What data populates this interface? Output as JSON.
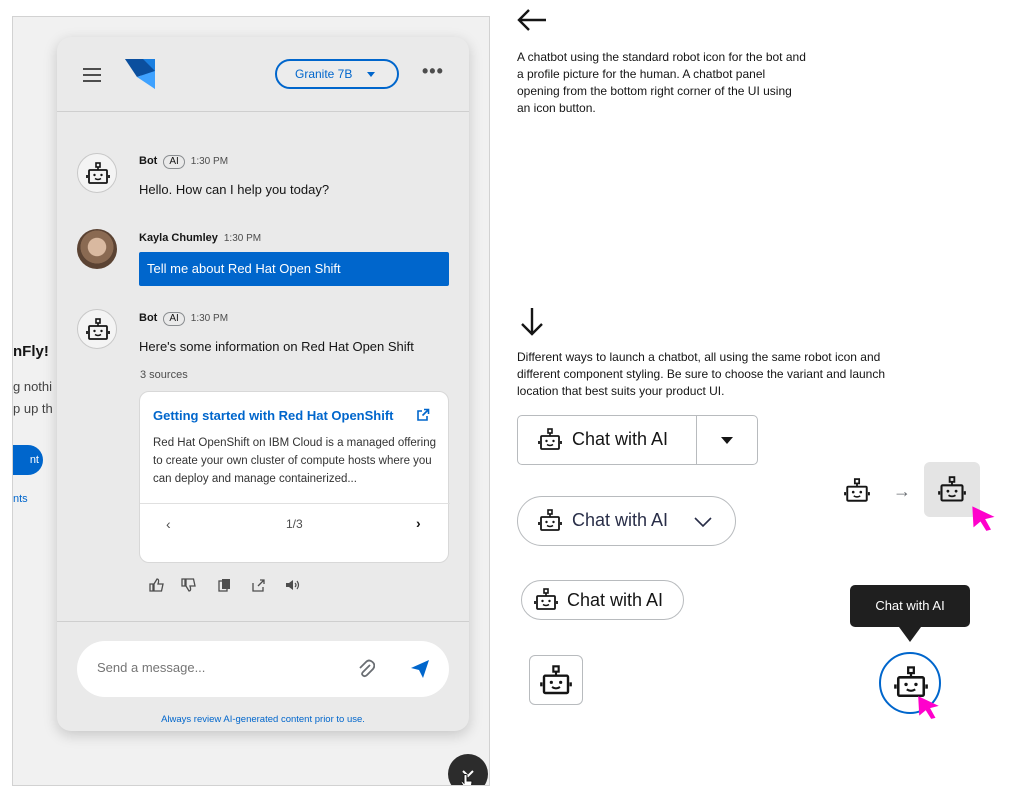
{
  "background_page": {
    "headline": "nFly!",
    "lines": [
      "g nothi",
      "p up th"
    ],
    "button_label": "nt",
    "link_label": "nts"
  },
  "chatbot": {
    "header": {
      "menu_icon": "hamburger-icon",
      "logo_icon": "app-logo",
      "model_selector": "Granite 7B",
      "options_icon": "kebab-icon"
    },
    "messages": [
      {
        "role": "bot",
        "name": "Bot",
        "badge": "AI",
        "time": "1:30 PM",
        "text": "Hello. How can I help you today?"
      },
      {
        "role": "user",
        "name": "Kayla Chumley",
        "time": "1:30 PM",
        "text": "Tell me about Red Hat Open Shift"
      },
      {
        "role": "bot",
        "name": "Bot",
        "badge": "AI",
        "time": "1:30 PM",
        "text": "Here's some information on Red Hat Open Shift"
      }
    ],
    "sources": {
      "label": "3 sources",
      "card_title": "Getting started with Red Hat OpenShift",
      "card_body": "Red Hat OpenShift on IBM Cloud is a managed offering to create your own cluster of compute hosts where you can deploy and manage containerized...",
      "pagination": "1/3"
    },
    "response_actions": [
      "thumbs-up-icon",
      "thumbs-down-icon",
      "copy-icon",
      "share-icon",
      "speaker-icon"
    ],
    "composer": {
      "placeholder": "Send a message...",
      "attach_icon": "paperclip-icon",
      "send_icon": "send-icon"
    },
    "disclaimer": "Always review AI-generated content prior to use."
  },
  "annotations": {
    "note_1": "A chatbot using the standard robot icon for the bot and a profile picture for the human. A chatbot panel opening from the bottom right corner of the UI using an  icon button.",
    "note_2": "Different ways to launch a chatbot, all using the same robot icon and different component styling. Be sure to choose the variant and launch location that best suits your product UI."
  },
  "launch_variants": {
    "split_button_label": "Chat with AI",
    "pill_button_label": "Chat with AI",
    "small_pill_label": "Chat with AI",
    "tooltip_label": "Chat with AI"
  },
  "colors": {
    "accent": "#0066cc",
    "cursor": "#ff00cc",
    "tooltip_bg": "#1f1f1f"
  }
}
